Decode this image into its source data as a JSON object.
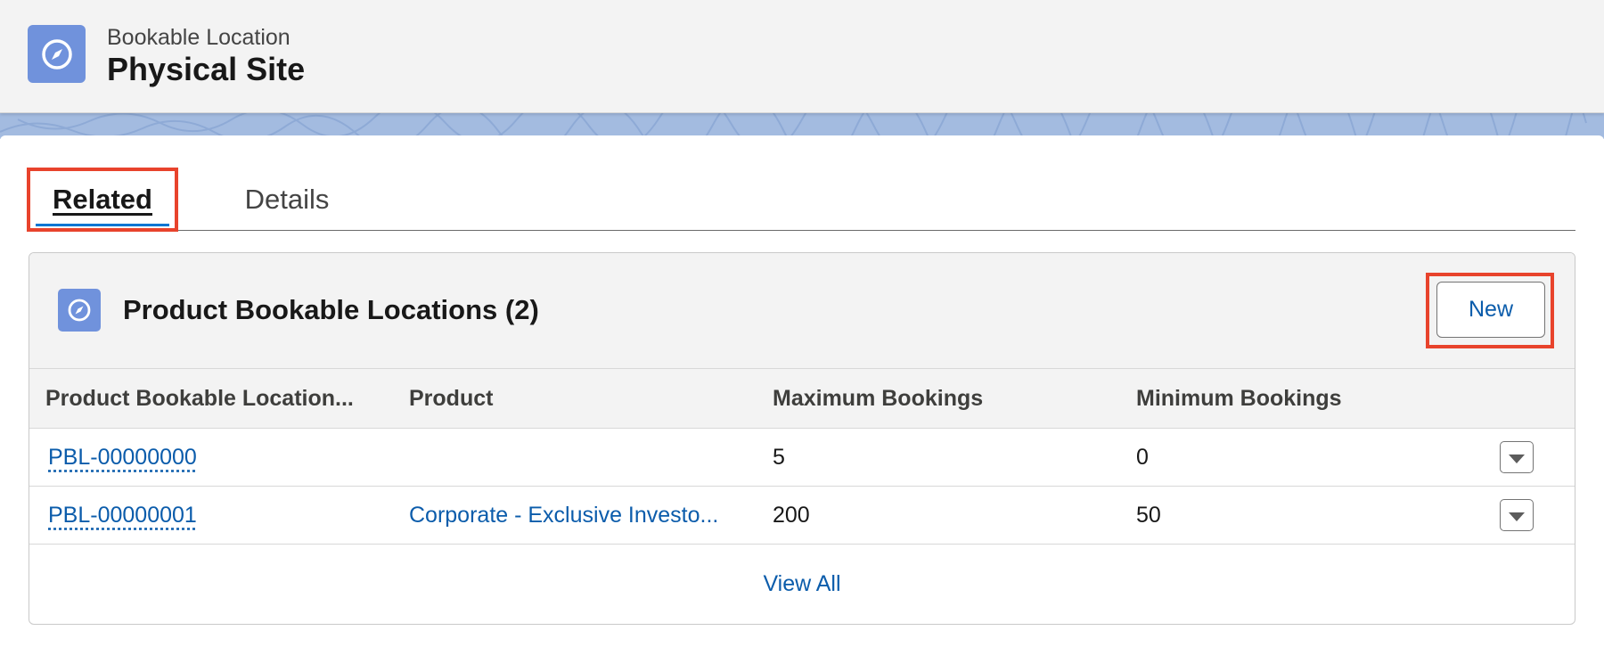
{
  "header": {
    "kicker": "Bookable Location",
    "title": "Physical Site",
    "icon": "compass-icon",
    "icon_color": "#7092dc"
  },
  "tabs": [
    {
      "label": "Related",
      "active": true,
      "highlighted": true
    },
    {
      "label": "Details",
      "active": false
    }
  ],
  "related_list": {
    "icon": "compass-icon",
    "title": "Product Bookable Locations (2)",
    "new_button": "New",
    "columns": [
      "Product Bookable Location...",
      "Product",
      "Maximum Bookings",
      "Minimum Bookings"
    ],
    "rows": [
      {
        "name": "PBL-00000000",
        "product": "",
        "max": "5",
        "min": "0"
      },
      {
        "name": "PBL-00000001",
        "product": "Corporate - Exclusive Investo...",
        "max": "200",
        "min": "50"
      }
    ],
    "view_all": "View All"
  },
  "colors": {
    "highlight_outline": "#e8432c",
    "link": "#0b5cab",
    "brand_band": "#a3bbe0"
  }
}
